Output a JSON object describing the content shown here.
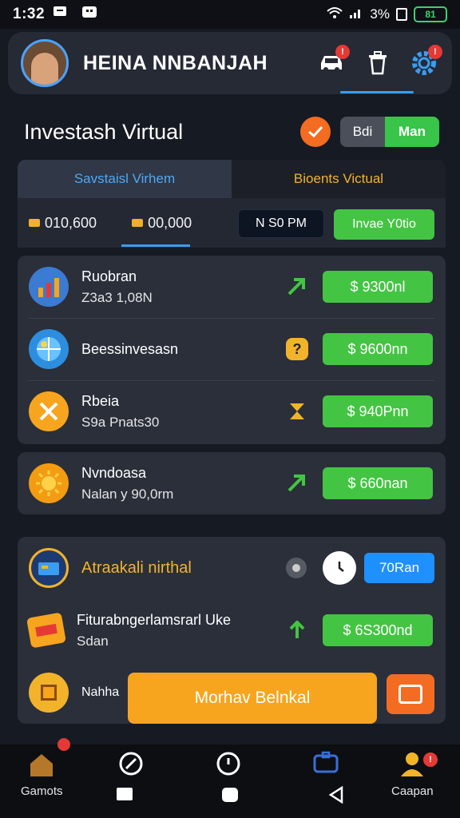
{
  "status_bar": {
    "time": "1:32",
    "battery_label": "81",
    "signal_percent": "3%"
  },
  "header": {
    "username": "HEINA NNBANJAH",
    "badge_car": "!",
    "badge_settings": "!"
  },
  "section": {
    "title": "Investash Virtual",
    "toggle_off": "Bdi",
    "toggle_on": "Man",
    "tab_active": "Savstaisl Virhem",
    "tab_inactive": "Bioents Victual",
    "stat_one": "010,600",
    "stat_two": "00,000",
    "time_label": "N S0 PM",
    "invest_label": "Invae Y0tio"
  },
  "list": [
    {
      "name": "Ruobran",
      "sub": "Z3a3 1,08N",
      "price": "$ 9300nl",
      "icon": "chart-icon",
      "mid_icon": "arrow-up-icon"
    },
    {
      "name": "Beessinvesasn",
      "sub": "",
      "price": "$ 9600nn",
      "icon": "globe-icon",
      "mid_icon": "question-icon"
    },
    {
      "name": "Rbeia",
      "sub": "S9a Pnats30",
      "price": "$ 940Pnn",
      "icon": "tools-icon",
      "mid_icon": "hourglass-icon"
    },
    {
      "name": "Nvndoasa",
      "sub": "Nalan y 90,0rm",
      "price": "$ 660nan",
      "icon": "sun-icon",
      "mid_icon": "arrow-up-icon"
    }
  ],
  "bottom": {
    "row1_name": "Atraakali nirthal",
    "row1_pill": "70Ran",
    "row2_name": "Fiturabngerlamsrarl Uke",
    "row2_sub": "Sdan",
    "row2_price": "$ 6S300nd",
    "row3_name": "Nahha",
    "cta_label": "Morhav Belnkal"
  },
  "nav": {
    "left_label": "Gamots",
    "right_label": "Caapan",
    "right_badge": "!"
  },
  "colors": {
    "accent_green": "#44c443",
    "accent_orange": "#f7a51e",
    "accent_blue": "#1e90ff"
  }
}
